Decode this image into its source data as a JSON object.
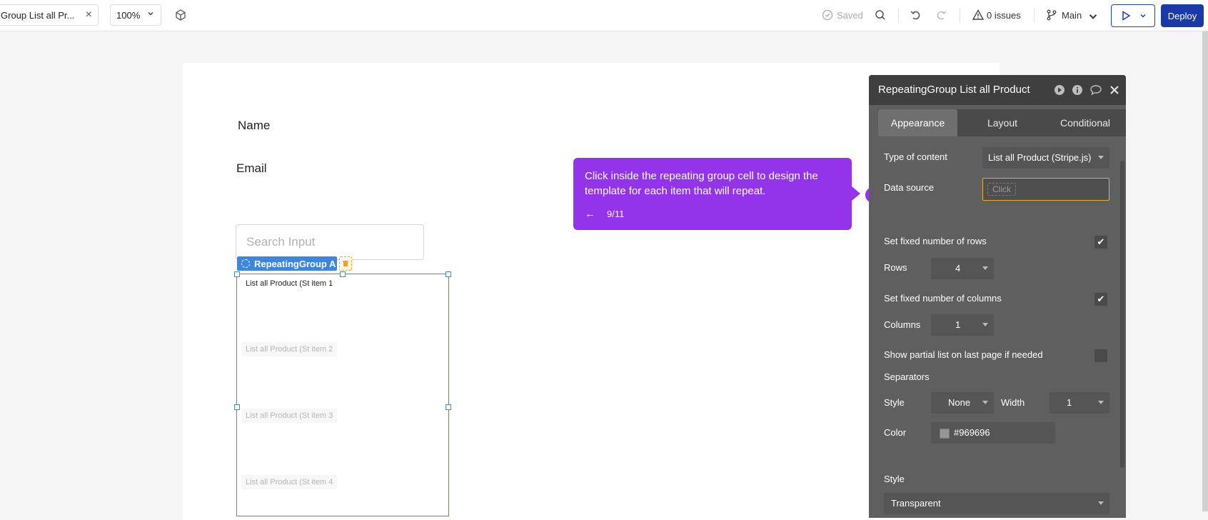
{
  "toolbar": {
    "page_tab_label": "Group List all Pr...",
    "zoom_value": "100%",
    "saved_label": "Saved",
    "issues_label": "0 issues",
    "branch_label": "Main",
    "deploy_label": "Deploy"
  },
  "canvas": {
    "name_label": "Name",
    "email_label": "Email",
    "search_placeholder": "Search Input",
    "rg_tag_label": "RepeatingGroup A",
    "items": [
      "List all Product (St item 1",
      "List all Product (St item 2",
      "List all Product (St item 3",
      "List all Product (St item 4"
    ]
  },
  "tooltip": {
    "message": "Click inside the repeating group cell to design the template for each item that will repeat.",
    "step": "9/11"
  },
  "panel": {
    "title": "RepeatingGroup List all Product",
    "tabs": [
      "Appearance",
      "Layout",
      "Conditional"
    ],
    "type_of_content_label": "Type of content",
    "type_of_content_value": "List all Product (Stripe.js)",
    "data_source_label": "Data source",
    "data_source_placeholder": "Click",
    "fixed_rows_label": "Set fixed number of rows",
    "fixed_rows_checked": true,
    "rows_label": "Rows",
    "rows_value": "4",
    "fixed_cols_label": "Set fixed number of columns",
    "fixed_cols_checked": true,
    "columns_label": "Columns",
    "columns_value": "1",
    "partial_list_label": "Show partial list on last page if needed",
    "partial_list_checked": false,
    "separators_label": "Separators",
    "style_label": "Style",
    "style_value": "None",
    "width_label": "Width",
    "width_value": "1",
    "color_label": "Color",
    "color_value": "#969696",
    "style2_label": "Style",
    "style2_value": "Transparent"
  },
  "colors": {
    "accent_purple": "#9333ea",
    "deploy_blue": "#1a3aa8",
    "selection_blue": "#3d86e0",
    "highlight_yellow": "#e2b23c"
  }
}
